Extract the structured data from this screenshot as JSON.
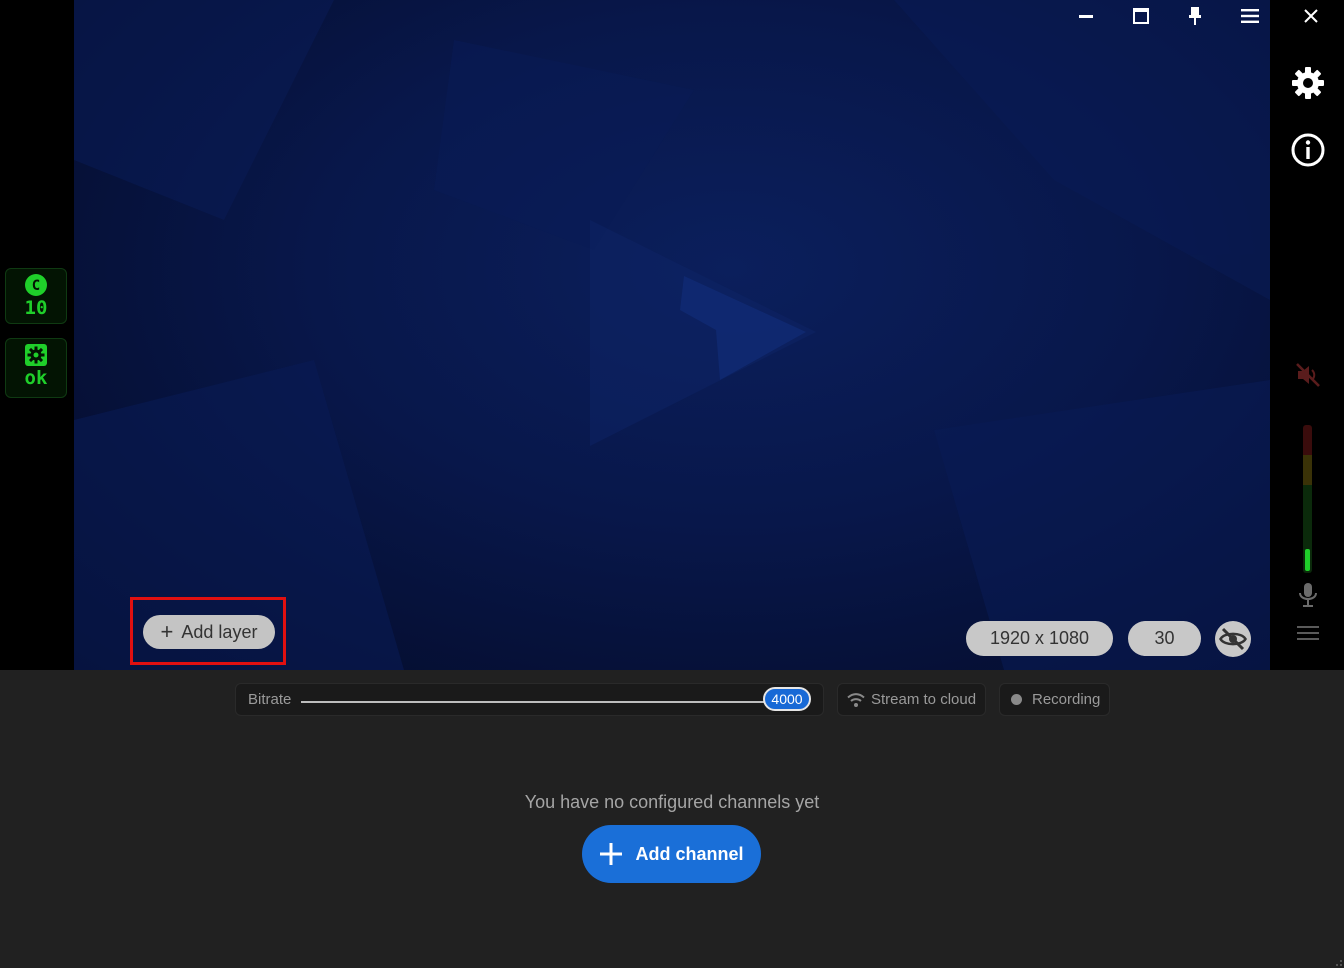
{
  "left_status": [
    {
      "icon": "cpu-c-icon",
      "letter": "C",
      "value": "10"
    },
    {
      "icon": "gear-icon",
      "value": "ok"
    }
  ],
  "window_controls": [
    "minimize-icon",
    "maximize-icon",
    "pin-icon",
    "menu-icon",
    "close-icon"
  ],
  "right_rail": [
    "settings-icon",
    "info-icon",
    "speaker-muted-icon",
    "audio-level-meter",
    "microphone-icon",
    "mixer-menu-icon"
  ],
  "audio_level": 0.15,
  "preview": {
    "add_layer_label": "Add layer",
    "resolution": "1920 x 1080",
    "fps": "30"
  },
  "controls": {
    "bitrate_label": "Bitrate",
    "bitrate_value": "4000",
    "stream_label": "Stream to cloud",
    "recording_label": "Recording"
  },
  "channels": {
    "empty_message": "You have no configured channels yet",
    "add_channel_label": "Add channel"
  },
  "colors": {
    "accent": "#1a6fd8",
    "status_green": "#1fcf2a",
    "highlight": "#e01010"
  }
}
